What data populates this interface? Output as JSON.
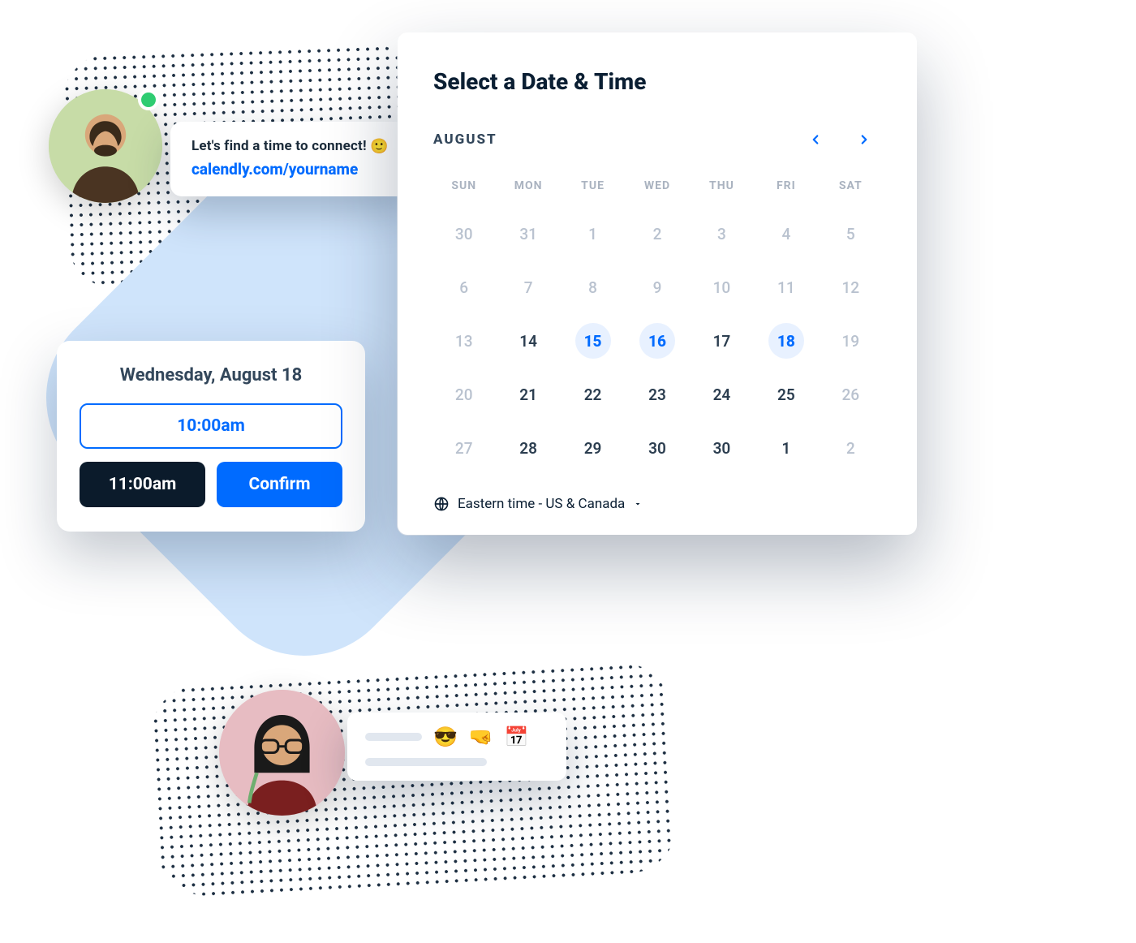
{
  "message": {
    "text": "Let's find a time to connect!",
    "emoji": "🙂",
    "link": "calendly.com/yourname"
  },
  "timepicker": {
    "heading": "Wednesday, August 18",
    "slot_primary": "10:00am",
    "slot_selected": "11:00am",
    "confirm_label": "Confirm"
  },
  "calendar": {
    "title": "Select a Date & Time",
    "month_label": "AUGUST",
    "dow": [
      "SUN",
      "MON",
      "TUE",
      "WED",
      "THU",
      "FRI",
      "SAT"
    ],
    "days": [
      {
        "n": "30",
        "state": "muted"
      },
      {
        "n": "31",
        "state": "muted"
      },
      {
        "n": "1",
        "state": "muted"
      },
      {
        "n": "2",
        "state": "muted"
      },
      {
        "n": "3",
        "state": "muted"
      },
      {
        "n": "4",
        "state": "muted"
      },
      {
        "n": "5",
        "state": "muted"
      },
      {
        "n": "6",
        "state": "muted"
      },
      {
        "n": "7",
        "state": "muted"
      },
      {
        "n": "8",
        "state": "muted"
      },
      {
        "n": "9",
        "state": "muted"
      },
      {
        "n": "10",
        "state": "muted"
      },
      {
        "n": "11",
        "state": "muted"
      },
      {
        "n": "12",
        "state": "muted"
      },
      {
        "n": "13",
        "state": "muted"
      },
      {
        "n": "14",
        "state": "normal"
      },
      {
        "n": "15",
        "state": "avail"
      },
      {
        "n": "16",
        "state": "avail"
      },
      {
        "n": "17",
        "state": "normal"
      },
      {
        "n": "18",
        "state": "avail"
      },
      {
        "n": "19",
        "state": "muted"
      },
      {
        "n": "20",
        "state": "muted"
      },
      {
        "n": "21",
        "state": "normal"
      },
      {
        "n": "22",
        "state": "normal"
      },
      {
        "n": "23",
        "state": "normal"
      },
      {
        "n": "24",
        "state": "normal"
      },
      {
        "n": "25",
        "state": "normal"
      },
      {
        "n": "26",
        "state": "muted"
      },
      {
        "n": "27",
        "state": "muted"
      },
      {
        "n": "28",
        "state": "normal"
      },
      {
        "n": "29",
        "state": "normal"
      },
      {
        "n": "30",
        "state": "normal"
      },
      {
        "n": "30",
        "state": "normal"
      },
      {
        "n": "1",
        "state": "normal"
      },
      {
        "n": "2",
        "state": "muted"
      }
    ],
    "timezone": "Eastern time - US & Canada"
  },
  "reply": {
    "emojis": "😎 🤜 📅"
  },
  "colors": {
    "accent": "#006bff",
    "ink": "#0b1f33"
  }
}
